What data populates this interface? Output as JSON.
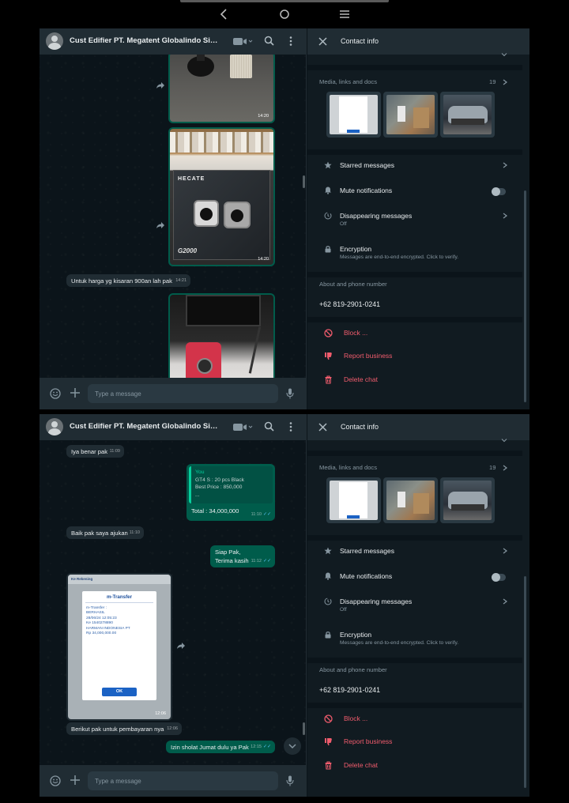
{
  "chat": {
    "title": "Cust Edifier PT. Megatent Globalindo Sinergi...",
    "composer_placeholder": "Type a message"
  },
  "panel1": {
    "image1_time": "14:20",
    "image2_time": "14:20",
    "image2_brand": "HECATE",
    "image2_model": "G2000",
    "msg_price": {
      "text": "Untuk harga yg kisaran 900an lah pak",
      "time": "14:21"
    }
  },
  "panel2": {
    "msg_iya": {
      "text": "Iya benar pak",
      "time": "11:09"
    },
    "msg_you": {
      "header": "You",
      "line1": "GT4 S : 20 pcs Black",
      "line2": "Best Price : 850,000",
      "line3": "...",
      "total": "Total : 34,000,000",
      "time": "11:10"
    },
    "msg_baik": {
      "text": "Baik pak saya ajukan",
      "time": "11:10"
    },
    "msg_siap": {
      "line1": "Siap Pak,",
      "line2": "Terima kasih",
      "time": "11:12"
    },
    "receipt": {
      "title": "m-Transfer",
      "header_text": "Ke Rekening",
      "status": "m-Transfer :",
      "result": "BERHASIL",
      "date": "28/06/24 12:05:23",
      "to": "Ke 1540278890",
      "name": "HARMAN INDONESIA PT",
      "amount": "Rp 34,000,000.00",
      "ok": "OK",
      "time": "12:06"
    },
    "msg_berikut": {
      "text": "Berikut pak untuk pembayaran nya",
      "time": "12:06"
    },
    "msg_izin": {
      "text": "Izin sholat Jumat dulu ya Pak",
      "time": "12:15"
    }
  },
  "info": {
    "title": "Contact info",
    "media_label": "Media, links and docs",
    "media_count": "19",
    "starred": "Starred messages",
    "mute": "Mute notifications",
    "disappearing": "Disappearing messages",
    "disappearing_sub": "Off",
    "encryption": "Encryption",
    "encryption_sub": "Messages are end-to-end encrypted. Click to verify.",
    "about_label": "About and phone number",
    "phone": "+62 819-2901-0241",
    "block": "Block ...",
    "report": "Report business",
    "delete": "Delete chat"
  },
  "colors": {
    "bg": "#0b141a",
    "panel": "#111b21",
    "header": "#202c33",
    "incoming": "#202c33",
    "outgoing": "#005c4b",
    "accent_blue": "#53bdeb",
    "danger": "#f15c6d",
    "muted": "#8696a0"
  },
  "icons": [
    "back-icon",
    "home-icon",
    "menu-icon",
    "video-icon",
    "search-icon",
    "kebab-icon",
    "emoji-icon",
    "plus-icon",
    "mic-icon",
    "close-icon",
    "star-icon",
    "bell-icon",
    "timer-icon",
    "lock-icon",
    "block-icon",
    "thumbs-down-icon",
    "trash-icon",
    "forward-icon",
    "chevron-down-icon"
  ]
}
